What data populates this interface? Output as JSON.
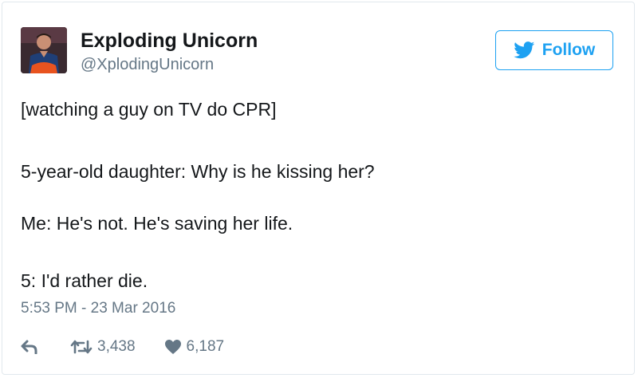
{
  "user": {
    "display_name": "Exploding Unicorn",
    "screen_name": "@XplodingUnicorn"
  },
  "follow_label": "Follow",
  "tweet": {
    "lines": [
      "[watching a guy on TV do CPR]",
      "5-year-old daughter: Why is he kissing her?",
      "Me: He's not. He's saving her life.",
      "5: I'd rather die."
    ],
    "timestamp": "5:53 PM - 23 Mar 2016"
  },
  "stats": {
    "retweets": "3,438",
    "likes": "6,187"
  },
  "icons": {
    "follow": "twitter-bird-icon",
    "reply": "reply-icon",
    "retweet": "retweet-icon",
    "like": "heart-icon"
  },
  "colors": {
    "accent": "#1da1f2",
    "text": "#14171a",
    "secondary": "#657786",
    "border": "#e1e8ed"
  }
}
